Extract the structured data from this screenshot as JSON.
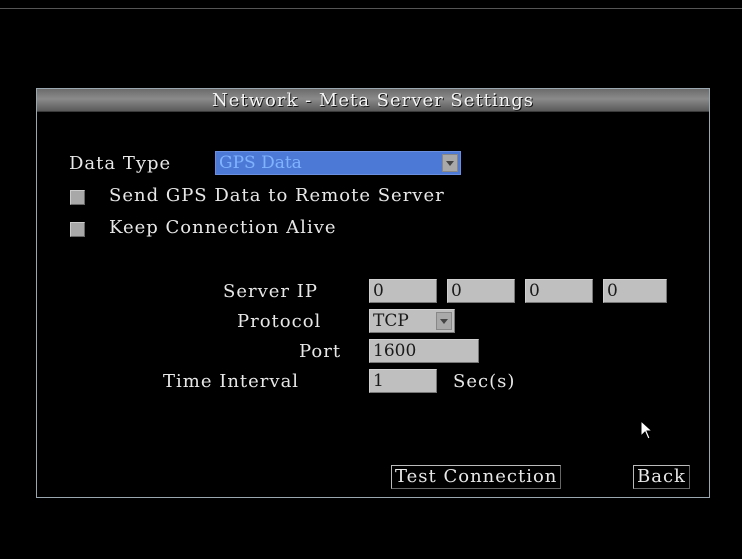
{
  "dialog": {
    "title": "Network - Meta Server Settings",
    "data_type": {
      "label": "Data Type",
      "value": "GPS Data"
    },
    "checkboxes": [
      {
        "label": "Send GPS Data to Remote Server"
      },
      {
        "label": "Keep Connection Alive"
      }
    ],
    "server_ip": {
      "label": "Server IP",
      "octets": [
        "0",
        "0",
        "0",
        "0"
      ]
    },
    "protocol": {
      "label": "Protocol",
      "value": "TCP"
    },
    "port": {
      "label": "Port",
      "value": "1600"
    },
    "time_interval": {
      "label": "Time Interval",
      "value": "1",
      "unit": "Sec(s)"
    },
    "buttons": {
      "test_connection": "Test Connection",
      "back": "Back"
    }
  }
}
